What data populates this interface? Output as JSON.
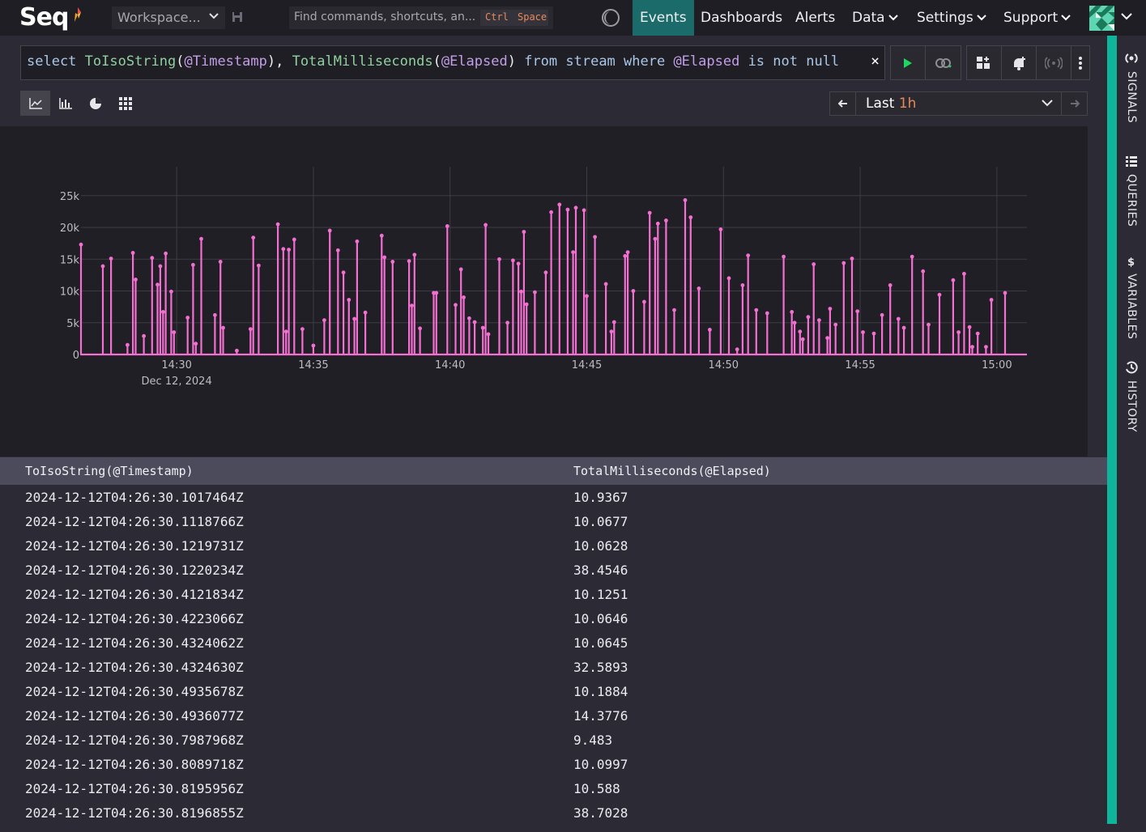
{
  "app": {
    "name": "Seq"
  },
  "topbar": {
    "workspace_label": "Workspace...",
    "search_placeholder": "Find commands, shortcuts, an...",
    "search_kbd_ctrl": "Ctrl",
    "search_kbd_space": "Space",
    "nav": [
      {
        "label": "Events",
        "active": true,
        "dropdown": false
      },
      {
        "label": "Dashboards",
        "active": false,
        "dropdown": false
      },
      {
        "label": "Alerts",
        "active": false,
        "dropdown": false
      },
      {
        "label": "Data",
        "active": false,
        "dropdown": true
      },
      {
        "label": "Settings",
        "active": false,
        "dropdown": true
      },
      {
        "label": "Support",
        "active": false,
        "dropdown": true
      }
    ]
  },
  "query": {
    "tokens": [
      {
        "t": "select ",
        "k": "kw"
      },
      {
        "t": "ToIsoString",
        "k": "fn"
      },
      {
        "t": "(",
        "k": "pl"
      },
      {
        "t": "@Timestamp",
        "k": "var"
      },
      {
        "t": "), ",
        "k": "pl"
      },
      {
        "t": "TotalMilliseconds",
        "k": "fn"
      },
      {
        "t": "(",
        "k": "pl"
      },
      {
        "t": "@Elapsed",
        "k": "var"
      },
      {
        "t": ") ",
        "k": "pl"
      },
      {
        "t": "from stream where ",
        "k": "kw"
      },
      {
        "t": "@Elapsed",
        "k": "var"
      },
      {
        "t": " is not null",
        "k": "kw"
      }
    ],
    "clear_symbol": "×"
  },
  "range": {
    "prefix": "Last ",
    "highlight": "1h"
  },
  "colors": {
    "series": "#f36fd1",
    "accent": "#0fb59a",
    "active_nav": "#1b6b6b"
  },
  "chart_data": {
    "type": "line",
    "xlabel": "",
    "ylabel": "",
    "x_ticks": [
      "14:30",
      "14:35",
      "14:40",
      "14:45",
      "14:50",
      "14:55",
      "15:00"
    ],
    "x_date_label": "Dec 12, 2024",
    "y_ticks": [
      "0",
      "5k",
      "10k",
      "15k",
      "20k",
      "25k"
    ],
    "ylim": [
      0,
      26500
    ],
    "xlim_minutes": [
      -3.5,
      31.1
    ],
    "grid": true,
    "series": [
      {
        "spikes": [
          [
            -3.5,
            17300
          ],
          [
            -2.7,
            13900
          ],
          [
            -2.4,
            15100
          ],
          [
            -1.8,
            1500
          ],
          [
            -1.6,
            16000
          ],
          [
            -1.5,
            11800
          ],
          [
            -1.2,
            2900
          ],
          [
            -0.9,
            15200
          ],
          [
            -0.7,
            11000
          ],
          [
            -0.6,
            13900
          ],
          [
            -0.5,
            6700
          ],
          [
            -0.4,
            15900
          ],
          [
            -0.2,
            9900
          ],
          [
            -0.1,
            3500
          ],
          [
            0.4,
            5800
          ],
          [
            0.6,
            14100
          ],
          [
            0.7,
            1700
          ],
          [
            0.9,
            18200
          ],
          [
            1.4,
            6200
          ],
          [
            1.6,
            14600
          ],
          [
            1.7,
            4200
          ],
          [
            2.2,
            600
          ],
          [
            2.7,
            4000
          ],
          [
            2.8,
            18400
          ],
          [
            3.0,
            14000
          ],
          [
            3.7,
            20500
          ],
          [
            3.9,
            16600
          ],
          [
            4.0,
            3600
          ],
          [
            4.1,
            16500
          ],
          [
            4.3,
            18100
          ],
          [
            4.6,
            4000
          ],
          [
            5.0,
            1400
          ],
          [
            5.4,
            5400
          ],
          [
            5.6,
            19500
          ],
          [
            5.9,
            16400
          ],
          [
            6.1,
            12900
          ],
          [
            6.3,
            8600
          ],
          [
            6.5,
            5600
          ],
          [
            6.6,
            17800
          ],
          [
            6.9,
            6600
          ],
          [
            7.5,
            18700
          ],
          [
            7.6,
            15300
          ],
          [
            7.9,
            14600
          ],
          [
            8.5,
            14700
          ],
          [
            8.6,
            7700
          ],
          [
            8.7,
            15700
          ],
          [
            8.9,
            4100
          ],
          [
            9.4,
            9700
          ],
          [
            9.5,
            9700
          ],
          [
            9.9,
            20200
          ],
          [
            10.2,
            7800
          ],
          [
            10.4,
            13400
          ],
          [
            10.5,
            9000
          ],
          [
            10.7,
            5700
          ],
          [
            10.9,
            5100
          ],
          [
            11.2,
            4200
          ],
          [
            11.3,
            20400
          ],
          [
            11.4,
            3200
          ],
          [
            11.8,
            15000
          ],
          [
            12.1,
            5000
          ],
          [
            12.3,
            14800
          ],
          [
            12.5,
            14300
          ],
          [
            12.6,
            9900
          ],
          [
            12.7,
            19300
          ],
          [
            12.8,
            7900
          ],
          [
            13.1,
            9800
          ],
          [
            13.5,
            12900
          ],
          [
            13.7,
            22400
          ],
          [
            14.0,
            23600
          ],
          [
            14.3,
            22800
          ],
          [
            14.5,
            16100
          ],
          [
            14.6,
            23100
          ],
          [
            14.9,
            22700
          ],
          [
            15.0,
            9200
          ],
          [
            15.3,
            18500
          ],
          [
            15.7,
            11100
          ],
          [
            15.9,
            3600
          ],
          [
            16.0,
            5100
          ],
          [
            16.4,
            15500
          ],
          [
            16.5,
            16100
          ],
          [
            16.7,
            10000
          ],
          [
            17.1,
            8300
          ],
          [
            17.3,
            22300
          ],
          [
            17.5,
            18200
          ],
          [
            17.6,
            20600
          ],
          [
            17.9,
            21100
          ],
          [
            18.2,
            7000
          ],
          [
            18.6,
            24300
          ],
          [
            18.8,
            21600
          ],
          [
            19.1,
            10400
          ],
          [
            19.5,
            3900
          ],
          [
            19.9,
            19700
          ],
          [
            20.2,
            12000
          ],
          [
            20.5,
            800
          ],
          [
            20.7,
            10900
          ],
          [
            20.9,
            15600
          ],
          [
            21.2,
            7000
          ],
          [
            21.6,
            6500
          ],
          [
            22.2,
            15400
          ],
          [
            22.5,
            6700
          ],
          [
            22.6,
            5000
          ],
          [
            22.8,
            3600
          ],
          [
            22.9,
            2400
          ],
          [
            23.1,
            5900
          ],
          [
            23.3,
            14200
          ],
          [
            23.5,
            5400
          ],
          [
            23.8,
            2600
          ],
          [
            23.9,
            7200
          ],
          [
            24.1,
            4700
          ],
          [
            24.4,
            14400
          ],
          [
            24.7,
            15100
          ],
          [
            24.9,
            6800
          ],
          [
            25.1,
            3500
          ],
          [
            25.5,
            3300
          ],
          [
            25.8,
            6200
          ],
          [
            26.1,
            10900
          ],
          [
            26.4,
            5600
          ],
          [
            26.6,
            4200
          ],
          [
            26.9,
            15400
          ],
          [
            27.3,
            13100
          ],
          [
            27.5,
            4700
          ],
          [
            27.9,
            9400
          ],
          [
            28.4,
            11700
          ],
          [
            28.6,
            3500
          ],
          [
            28.8,
            12700
          ],
          [
            29.0,
            4300
          ],
          [
            29.1,
            1200
          ],
          [
            29.3,
            3300
          ],
          [
            29.6,
            1200
          ],
          [
            29.8,
            8600
          ],
          [
            30.3,
            9700
          ]
        ]
      }
    ]
  },
  "table": {
    "headers": [
      "ToIsoString(@Timestamp)",
      "TotalMilliseconds(@Elapsed)"
    ],
    "rows": [
      [
        "2024-12-12T04:26:30.1017464Z",
        "10.9367"
      ],
      [
        "2024-12-12T04:26:30.1118766Z",
        "10.0677"
      ],
      [
        "2024-12-12T04:26:30.1219731Z",
        "10.0628"
      ],
      [
        "2024-12-12T04:26:30.1220234Z",
        "38.4546"
      ],
      [
        "2024-12-12T04:26:30.4121834Z",
        "10.1251"
      ],
      [
        "2024-12-12T04:26:30.4223066Z",
        "10.0646"
      ],
      [
        "2024-12-12T04:26:30.4324062Z",
        "10.0645"
      ],
      [
        "2024-12-12T04:26:30.4324630Z",
        "32.5893"
      ],
      [
        "2024-12-12T04:26:30.4935678Z",
        "10.1884"
      ],
      [
        "2024-12-12T04:26:30.4936077Z",
        "14.3776"
      ],
      [
        "2024-12-12T04:26:30.7987968Z",
        "9.483"
      ],
      [
        "2024-12-12T04:26:30.8089718Z",
        "10.0997"
      ],
      [
        "2024-12-12T04:26:30.8195956Z",
        "10.588"
      ],
      [
        "2024-12-12T04:26:30.8196855Z",
        "38.7028"
      ]
    ]
  },
  "sidebar": [
    {
      "label": "SIGNALS",
      "icon": "signals-icon"
    },
    {
      "label": "QUERIES",
      "icon": "queries-icon"
    },
    {
      "label": "VARIABLES",
      "icon": "variables-icon"
    },
    {
      "label": "HISTORY",
      "icon": "history-icon"
    }
  ]
}
